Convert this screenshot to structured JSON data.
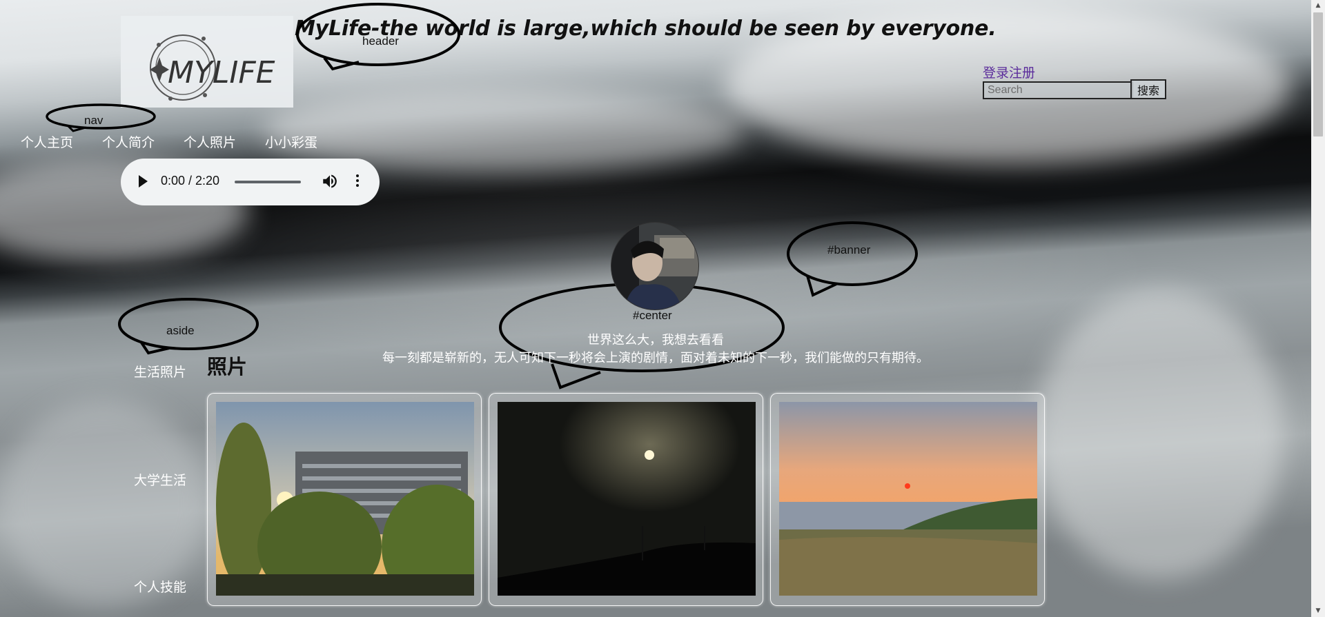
{
  "header": {
    "logo_text": "MYLIFE",
    "title": "MyLife-the world is large,which should be seen by everyone.",
    "login_link": "登录注册",
    "search_placeholder": "Search",
    "search_button": "搜索"
  },
  "annotations": {
    "header": "header",
    "nav": "nav",
    "banner": "#banner",
    "center": "#center",
    "aside": "aside"
  },
  "nav": {
    "items": [
      {
        "label": "个人主页"
      },
      {
        "label": "个人简介"
      },
      {
        "label": "个人照片"
      },
      {
        "label": "小小彩蛋"
      }
    ]
  },
  "audio": {
    "time": "0:00 / 2:20",
    "current_fraction": 0
  },
  "banner": {
    "line1": "世界这么大，我想去看看",
    "line2": "每一刻都是崭新的，无人可知下一秒将会上演的剧情，面对着未知的下一秒，我们能做的只有期待。"
  },
  "aside": {
    "items": [
      {
        "label": "生活照片"
      },
      {
        "label": "大学生活"
      },
      {
        "label": "个人技能"
      }
    ]
  },
  "main": {
    "heading": "照片",
    "photos": [
      {
        "name": "sunset-building-photo"
      },
      {
        "name": "night-moon-photo"
      },
      {
        "name": "mountain-sunset-photo"
      }
    ]
  }
}
